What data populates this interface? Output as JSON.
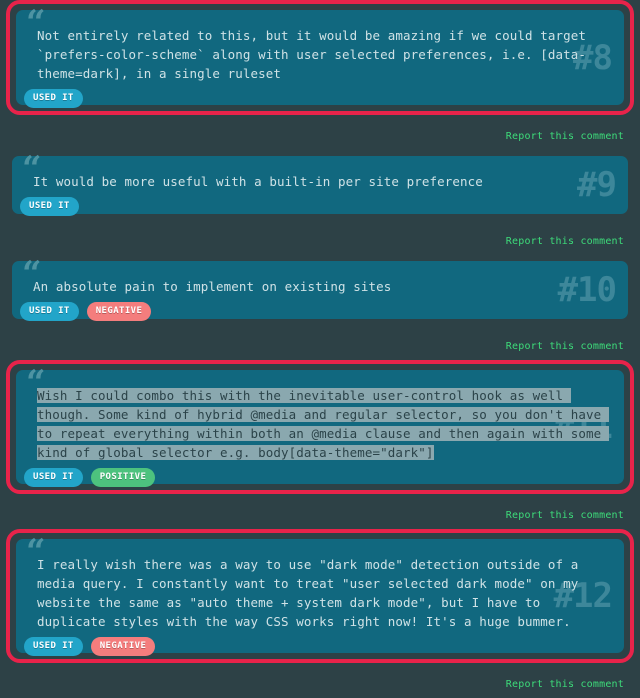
{
  "page": {
    "background_color": "#2d4146",
    "card_color": "#11687f",
    "focus_ring_color": "#e8234a",
    "report_link_color": "#3ddc7a",
    "quote_mark_glyph": "“",
    "report_label": "Report this comment"
  },
  "tag_colors": {
    "used_it": "#22a5c9",
    "negative": "#f47d7d",
    "positive": "#4dc27e"
  },
  "comments": [
    {
      "number": "#8",
      "focused": true,
      "text": "Not entirely related to this, but it would be amazing if we could target `prefers-color-scheme` along with user selected preferences, i.e. [data-theme=dark], in a single ruleset",
      "selection": null,
      "tags": [
        "USED IT"
      ],
      "report_label": "Report this comment"
    },
    {
      "number": "#9",
      "focused": false,
      "text": "It would be more useful with a built-in per site preference",
      "selection": null,
      "tags": [
        "USED IT"
      ],
      "report_label": "Report this comment"
    },
    {
      "number": "#10",
      "focused": false,
      "text": "An absolute pain to implement on existing sites",
      "selection": null,
      "tags": [
        "USED IT",
        "NEGATIVE"
      ],
      "report_label": "Report this comment"
    },
    {
      "number": "#11",
      "focused": true,
      "text": "Wish I could combo this with the inevitable user-control hook as well though. Some kind of hybrid @media and regular selector, so you don't have to repeat everything within both an @media clause and then again with some kind of global selector e.g. body[data-theme=\"dark\"]",
      "selection": "Wish I could combo this with the inevitable user-control hook as well though. Some kind of hybrid @media and regular selector, so you don't have to repeat everything within both an @media clause and then again with some kind of global selector e.g. body[data-theme=\"dark\"]",
      "tags": [
        "USED IT",
        "POSITIVE"
      ],
      "report_label": "Report this comment"
    },
    {
      "number": "#12",
      "focused": true,
      "text": "I really wish there was a way to use \"dark mode\" detection outside of a media query. I constantly want to treat \"user selected dark mode\" on my website the same as \"auto theme + system dark mode\", but I have to duplicate styles with the way CSS works right now! It's a huge bummer.",
      "selection": null,
      "tags": [
        "USED IT",
        "NEGATIVE"
      ],
      "report_label": "Report this comment"
    }
  ]
}
